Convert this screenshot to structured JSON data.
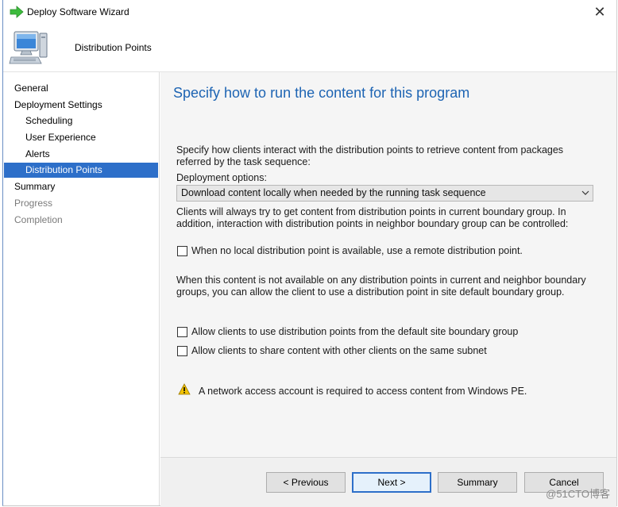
{
  "window": {
    "title": "Deploy Software Wizard",
    "close_glyph": "✕"
  },
  "header": {
    "page_name": "Distribution Points",
    "icon": "computer-icon"
  },
  "nav": {
    "items": [
      {
        "label": "General",
        "level": 0,
        "state": "normal"
      },
      {
        "label": "Deployment Settings",
        "level": 0,
        "state": "normal"
      },
      {
        "label": "Scheduling",
        "level": 1,
        "state": "normal"
      },
      {
        "label": "User Experience",
        "level": 1,
        "state": "normal"
      },
      {
        "label": "Alerts",
        "level": 1,
        "state": "normal"
      },
      {
        "label": "Distribution Points",
        "level": 1,
        "state": "selected"
      },
      {
        "label": "Summary",
        "level": 0,
        "state": "normal"
      },
      {
        "label": "Progress",
        "level": 0,
        "state": "disabled"
      },
      {
        "label": "Completion",
        "level": 0,
        "state": "disabled"
      }
    ]
  },
  "main": {
    "title": "Specify how to run the content for this program",
    "intro": "Specify how clients interact with the distribution points to retrieve content from packages referred by the task sequence:",
    "deployment_options_label": "Deployment options:",
    "deployment_option_selected": "Download content locally when needed by the running task sequence",
    "boundary_info": "Clients will always try to get content from distribution points in current boundary group. In addition, interaction with distribution points in neighbor boundary group can be controlled:",
    "cb_remote_dp": {
      "label": "When no local distribution point is available, use a remote distribution point.",
      "checked": false
    },
    "default_group_info": "When this content is not available on any distribution points in current and neighbor boundary groups, you can allow the client to use a distribution point in site default boundary group.",
    "cb_default_site_group": {
      "label": "Allow clients to use distribution points from the default site boundary group",
      "checked": false
    },
    "cb_share_subnet": {
      "label": "Allow clients to share content with other clients on the same subnet",
      "checked": false
    },
    "warning": "A network access account is required to access content from Windows PE."
  },
  "footer": {
    "previous": "< Previous",
    "next": "Next >",
    "summary": "Summary",
    "cancel": "Cancel"
  },
  "watermark": "@51CTO博客",
  "colors": {
    "accent": "#2d6fc9",
    "title_blue": "#1d64b3",
    "warning": "#f2c200"
  }
}
